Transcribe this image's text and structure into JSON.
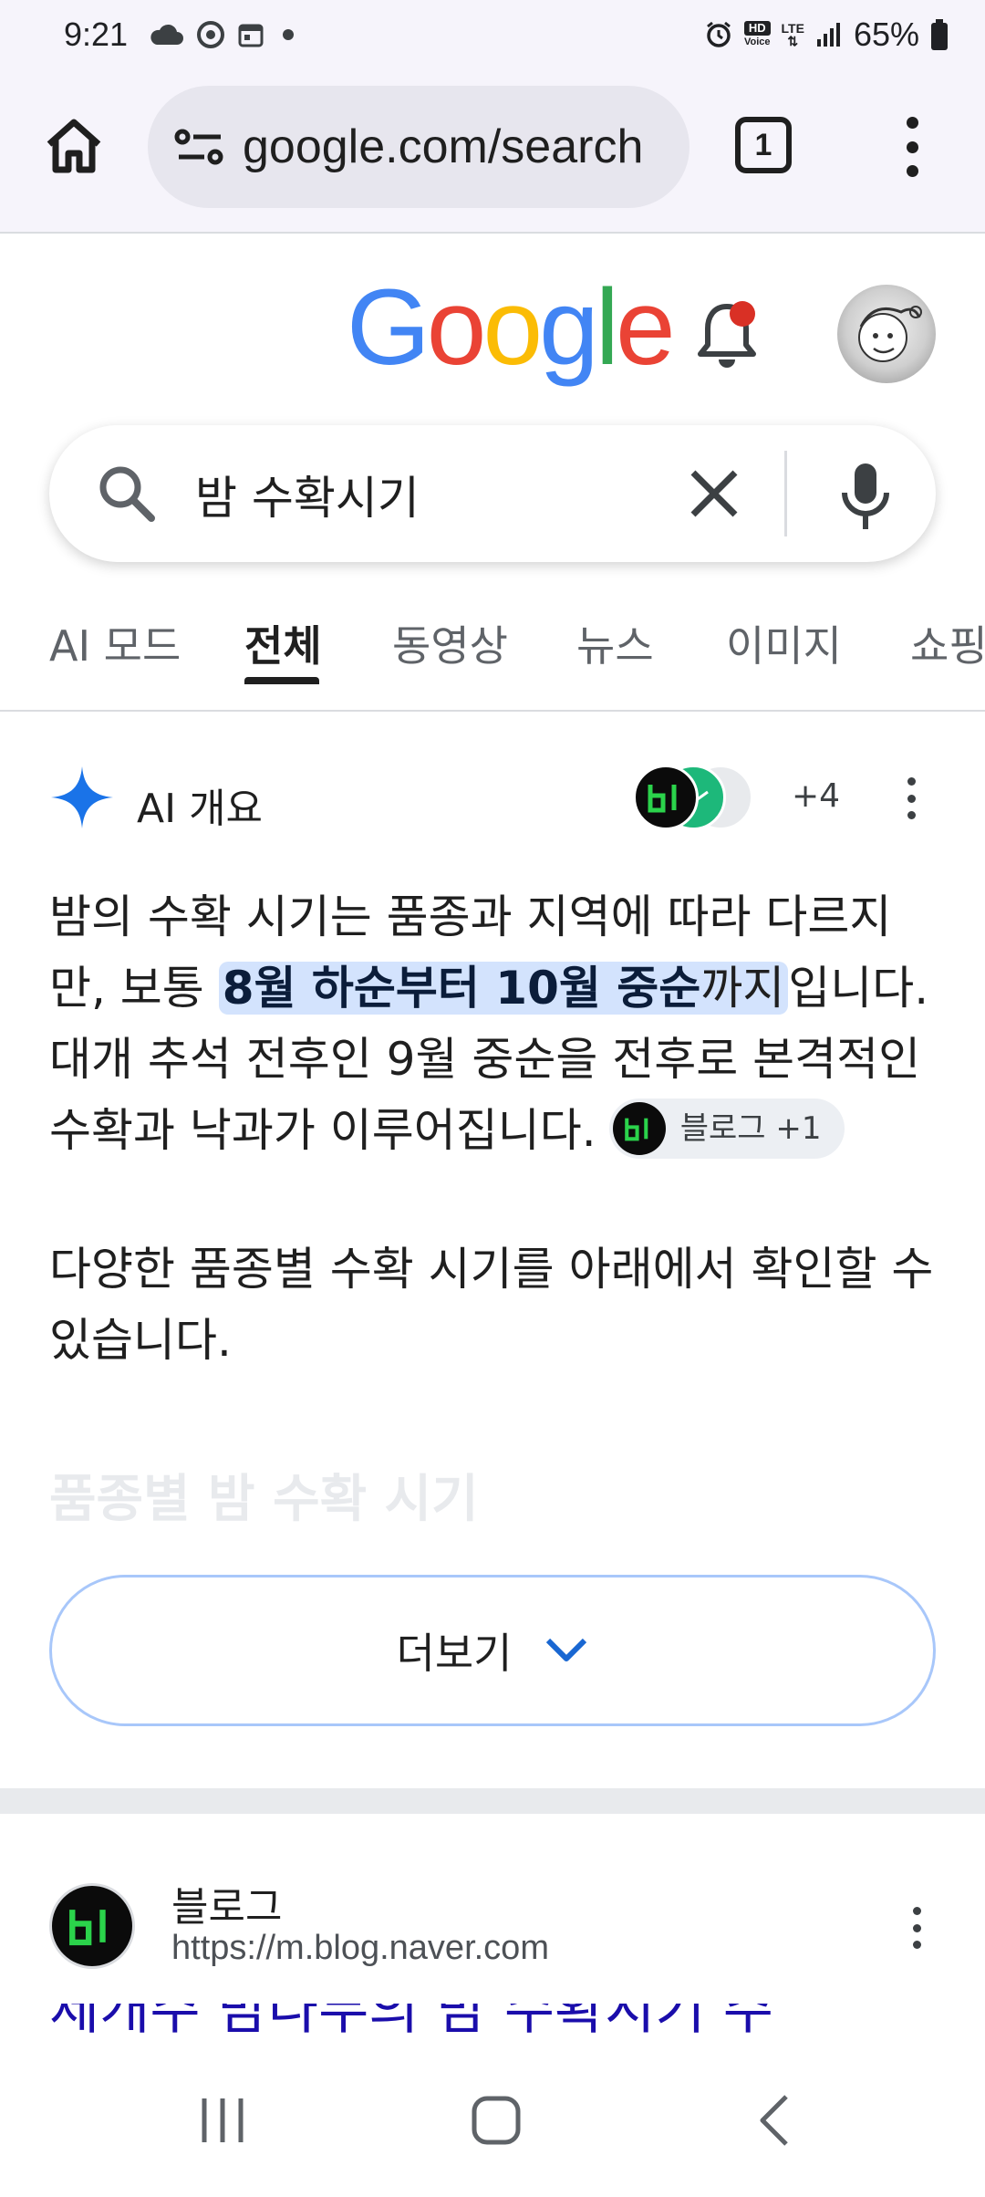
{
  "status_bar": {
    "time": "9:21",
    "battery": "65%",
    "lte": "LTE",
    "hd": "HD",
    "voice": "Voice"
  },
  "browser": {
    "url": "google.com/search",
    "tab_count": "1"
  },
  "google": {
    "logo_letters": [
      "G",
      "o",
      "o",
      "g",
      "l",
      "e"
    ],
    "logo_colors": [
      "#4285F4",
      "#EA4335",
      "#FBBC05",
      "#4285F4",
      "#34A853",
      "#EA4335"
    ]
  },
  "search": {
    "query": "밤 수확시기"
  },
  "tabs": [
    "AI 모드",
    "전체",
    "동영상",
    "뉴스",
    "이미지",
    "쇼핑"
  ],
  "ai_overview": {
    "title": "AI 개요",
    "source_count": "+4",
    "para1_before": "밤의 수확 시기는 품종과 지역에 따라 다르지만, 보통 ",
    "para1_highlight_bold": "8월 하순부터 10월 중순",
    "para1_highlight_rest": "까지",
    "para1_after": "입니다. 대개 추석 전후인 9월 중순을 전후로 본격적인 수확과 낙과가 이루어집니다.",
    "chip_label": "블로그 +1",
    "para2": "다양한 품종별 수확 시기를 아래에서 확인할 수 있습니다.",
    "faded_heading": "품종별 밤 수확 시기",
    "more_button": "더보기"
  },
  "result": {
    "site_name": "블로그",
    "url": "https://m.blog.naver.com",
    "title": "제개주 밤나무의 밤 수확시기 주"
  }
}
